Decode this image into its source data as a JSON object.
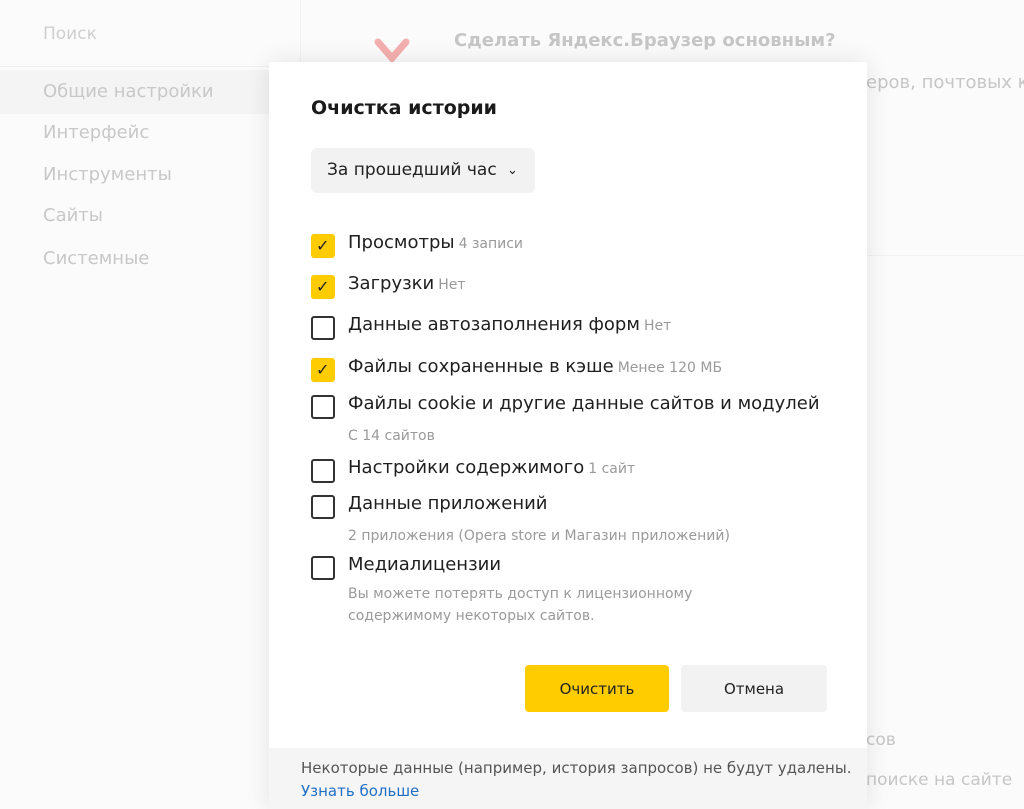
{
  "background": {
    "search_placeholder": "Поиск",
    "nav": [
      {
        "label": "Общие настройки"
      },
      {
        "label": "Интерфейс"
      },
      {
        "label": "Инструменты"
      },
      {
        "label": "Сайты"
      },
      {
        "label": "Системные"
      }
    ],
    "promo_title": "Сделать Яндекс.Браузер основным?",
    "fragment_1": "еров, почтовых кл",
    "fragment_2": "сов",
    "fragment_3": "поиске на сайте"
  },
  "dialog": {
    "title": "Очистка истории",
    "period": {
      "selected": "За прошедший час"
    },
    "options": [
      {
        "label": "Просмотры",
        "meta": "4 записи",
        "checked": true
      },
      {
        "label": "Загрузки",
        "meta": "Нет",
        "checked": true
      },
      {
        "label": "Данные автозаполнения форм",
        "meta": "Нет",
        "checked": false
      },
      {
        "label": "Файлы сохраненные в кэше",
        "meta": "Менее 120 МБ",
        "checked": true
      },
      {
        "label": "Файлы cookie и другие данные сайтов и модулей",
        "sub": "С 14 сайтов",
        "checked": false
      },
      {
        "label": "Настройки содержимого",
        "meta": "1 сайт",
        "checked": false
      },
      {
        "label": "Данные приложений",
        "sub": "2 приложения (Opera store и Магазин приложений)",
        "checked": false
      },
      {
        "label": "Медиалицензии",
        "sub1": "Вы можете потерять доступ к лицензионному",
        "sub2": "содержимому некоторых сайтов.",
        "checked": false
      }
    ],
    "buttons": {
      "clear": "Очистить",
      "cancel": "Отмена"
    },
    "footer": {
      "note": "Некоторые данные (например, история запросов) не будут удалены.",
      "link": "Узнать больше"
    }
  },
  "colors": {
    "accent": "#ffcc00",
    "link": "#1f6fc5"
  }
}
